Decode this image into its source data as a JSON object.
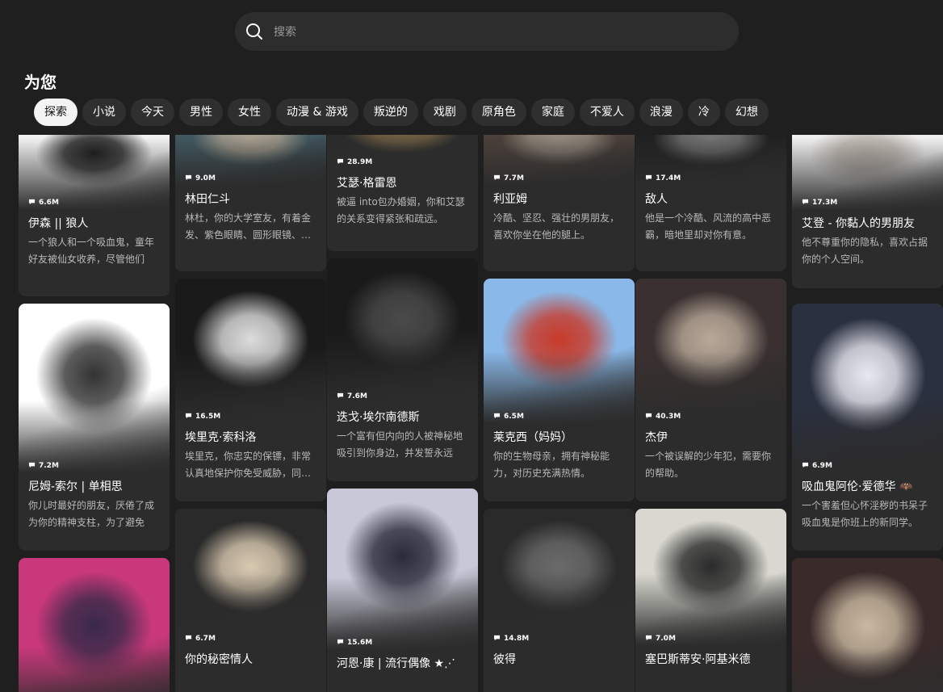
{
  "search": {
    "placeholder": "搜索"
  },
  "section_title": "为您",
  "chips": [
    "探索",
    "小说",
    "今天",
    "男性",
    "女性",
    "动漫 & 游戏",
    "叛逆的",
    "戏剧",
    "原角色",
    "家庭",
    "不爱人",
    "浪漫",
    "冷",
    "幻想"
  ],
  "columns": [
    [
      {
        "stat": "6.6M",
        "name": "伊森 || 狼人",
        "desc": "一个狼人和一个吸血鬼，童年好友被仙女收养，尽管他们的…",
        "art": "dark-haired boy with earrings"
      },
      {
        "stat": "7.2M",
        "name": "尼姆-索尔 | 单相思",
        "desc": "你儿时最好的朋友，厌倦了成为你的精神支柱，为了避免更…",
        "art": "black and white sketch of boy"
      },
      {
        "stat": "",
        "name": "",
        "desc": "",
        "art": "colorful group illustration"
      }
    ],
    [
      {
        "stat": "9.0M",
        "name": "林田仁斗",
        "desc": "林杜，你的大学室友，有着金发、紫色眼睛、圆形眼镜、…",
        "art": "blond boy holding phone"
      },
      {
        "stat": "16.5M",
        "name": "埃里克·索科洛",
        "desc": "埃里克，你忠实的保镖，非常认真地保护你免受威胁，同…",
        "art": "white-haired man smoking"
      },
      {
        "stat": "6.7M",
        "name": "你的秘密情人",
        "desc": "",
        "art": "blond man with glasses"
      }
    ],
    [
      {
        "stat": "28.9M",
        "name": "艾瑟·格雷恩",
        "desc": "被逼 into包办婚姻，你和艾瑟的关系变得紧张和疏远。",
        "art": "man in suit"
      },
      {
        "stat": "7.6M",
        "name": "迭戈·埃尔南德斯",
        "desc": "一个富有但内向的人被神秘地吸引到你身边，并发誓永远把…",
        "art": "man in black suit"
      },
      {
        "stat": "15.6M",
        "name": "河恩·康 | 流行偶像 ★⋰",
        "desc": "",
        "art": "silver-haired idol with mic"
      }
    ],
    [
      {
        "stat": "7.7M",
        "name": "利亚姆",
        "desc": "冷酷、坚忍、强壮的男朋友，喜欢你坐在他的腿上。",
        "art": "man in trench coat"
      },
      {
        "stat": "6.5M",
        "name": "莱克西（妈妈）",
        "desc": "你的生物母亲，拥有神秘能力，对历史充满热情。",
        "art": "red-haired fox girl"
      },
      {
        "stat": "14.8M",
        "name": "彼得",
        "desc": "",
        "art": "man in black shirt"
      }
    ],
    [
      {
        "stat": "17.4M",
        "name": "敌人",
        "desc": "他是一个冷酷、风流的高中恶霸，暗地里却对你有意。",
        "art": "boy on motorcycle"
      },
      {
        "stat": "40.3M",
        "name": "杰伊",
        "desc": "一个被误解的少年犯，需要你的帮助。",
        "art": "grey-haired boy with cat"
      },
      {
        "stat": "7.0M",
        "name": "塞巴斯蒂安·阿基米德",
        "desc": "",
        "art": "man in suit with cigarette"
      }
    ],
    [
      {
        "stat": "17.3M",
        "name": "艾登 - 你黏人的男朋友",
        "desc": "他不尊重你的隐私，喜欢占据你的个人空间。",
        "art": "boy at desk"
      },
      {
        "stat": "6.9M",
        "name": "吸血鬼阿伦·爱德华 🦇",
        "desc": "一个害羞但心怀淫秽的书呆子吸血鬼是你班上的新同学。",
        "art": "boy with glasses"
      },
      {
        "stat": "",
        "name": "",
        "desc": "",
        "art": "blond boy with roses"
      }
    ]
  ]
}
